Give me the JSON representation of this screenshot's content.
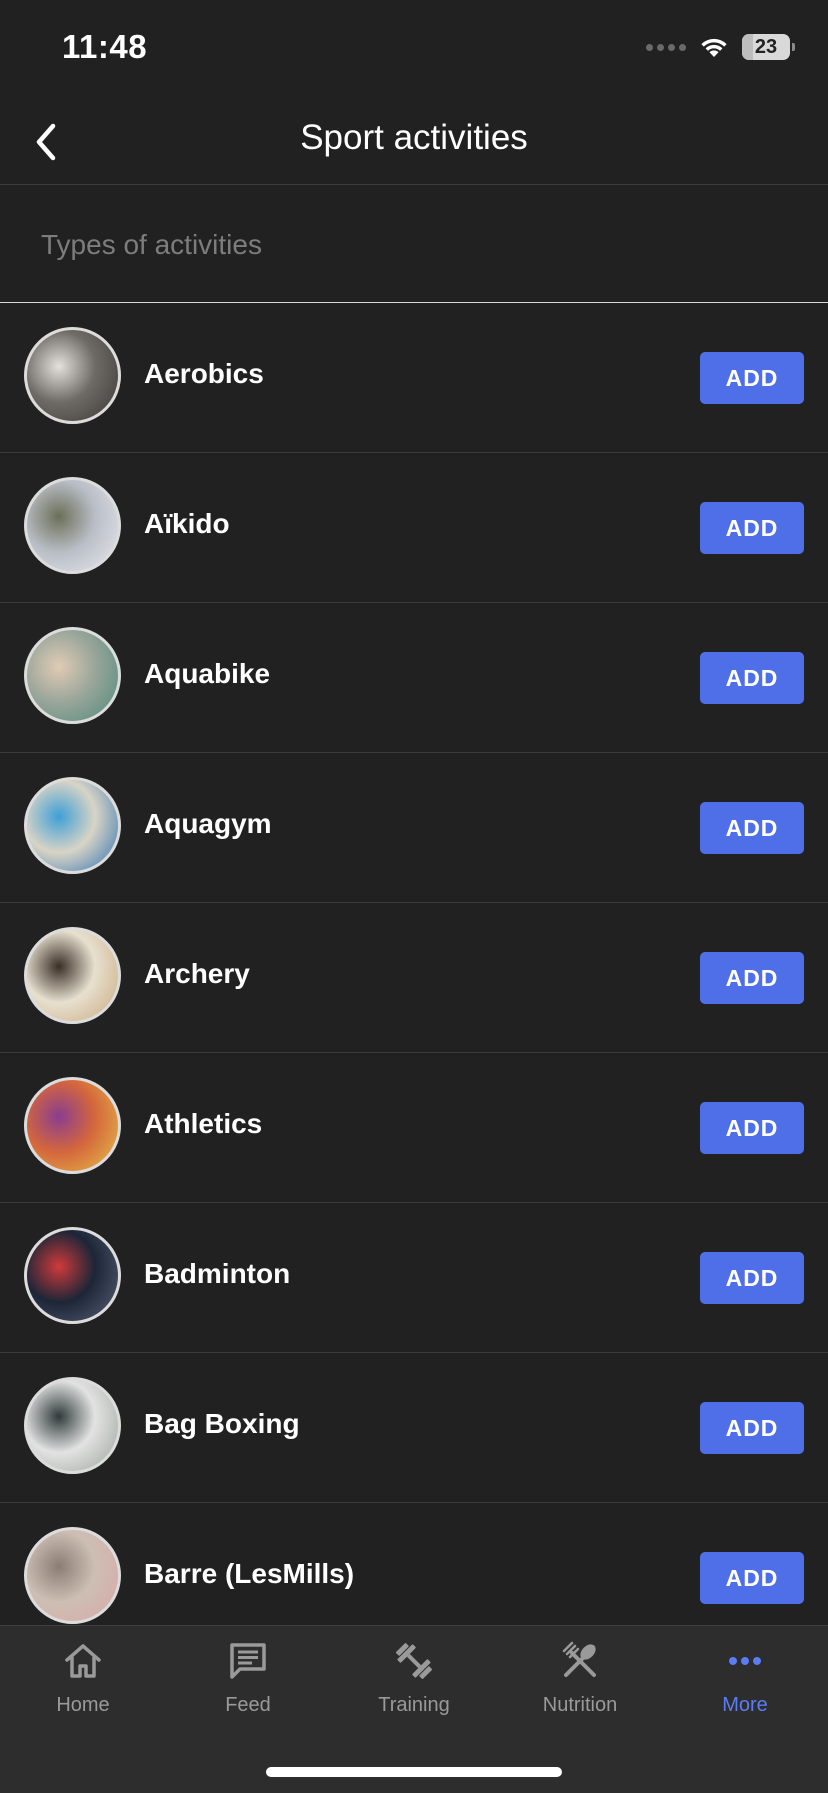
{
  "status_bar": {
    "time": "11:48",
    "battery": "23",
    "battery_level": 0.23
  },
  "header": {
    "title": "Sport activities"
  },
  "section": {
    "label": "Types of activities"
  },
  "add_label": "ADD",
  "activities": [
    {
      "name": "Aerobics",
      "colors": [
        "#6e6a66",
        "#e4e1dd",
        "#3b3734"
      ]
    },
    {
      "name": "Aïkido",
      "colors": [
        "#b9bec6",
        "#6b6f58",
        "#e8eaee"
      ]
    },
    {
      "name": "Aquabike",
      "colors": [
        "#9aa69a",
        "#e0cbb4",
        "#4c8a7c"
      ]
    },
    {
      "name": "Aquagym",
      "colors": [
        "#d8d4c6",
        "#3f9fd6",
        "#2a6fb0"
      ]
    },
    {
      "name": "Archery",
      "colors": [
        "#e7e0cf",
        "#3a2e26",
        "#c9a77c"
      ]
    },
    {
      "name": "Athletics",
      "colors": [
        "#d4673c",
        "#8a3d8f",
        "#e6c34a"
      ]
    },
    {
      "name": "Badminton",
      "colors": [
        "#1c2637",
        "#cf3a3a",
        "#5c6478"
      ]
    },
    {
      "name": "Bag Boxing",
      "colors": [
        "#e2e2e2",
        "#2f3b3a",
        "#9aa29a"
      ]
    },
    {
      "name": "Barre (LesMills)",
      "colors": [
        "#cdbfb3",
        "#8a7d74",
        "#d9a7a7"
      ]
    }
  ],
  "tabs": [
    {
      "label": "Home",
      "icon": "home-icon",
      "active": false
    },
    {
      "label": "Feed",
      "icon": "feed-icon",
      "active": false
    },
    {
      "label": "Training",
      "icon": "dumbbell-icon",
      "active": false
    },
    {
      "label": "Nutrition",
      "icon": "fork-spoon-icon",
      "active": false
    },
    {
      "label": "More",
      "icon": "more-icon",
      "active": true
    }
  ],
  "colors": {
    "background": "#212121",
    "accent": "#4f6fe8",
    "tab_active": "#5b7cf2",
    "tab_inactive": "#9a9a9a"
  }
}
